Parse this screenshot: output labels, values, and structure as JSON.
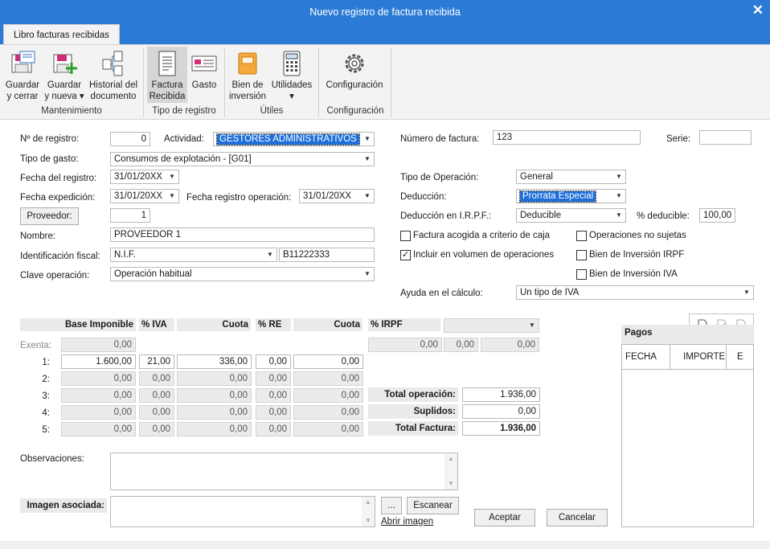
{
  "window": {
    "title": "Nuevo registro de factura recibida",
    "close": "✕"
  },
  "tab": "Libro facturas recibidas",
  "ribbon": {
    "buttons": [
      {
        "l1": "Guardar",
        "l2": "y cerrar"
      },
      {
        "l1": "Guardar",
        "l2": "y nueva ▾"
      },
      {
        "l1": "Historial del",
        "l2": "documento"
      },
      {
        "l1": "Factura",
        "l2": "Recibida"
      },
      {
        "l1": "Gasto",
        "l2": ""
      },
      {
        "l1": "Bien de",
        "l2": "inversión"
      },
      {
        "l1": "Utilidades",
        "l2": "▾"
      },
      {
        "l1": "Configuración",
        "l2": ""
      }
    ],
    "groups": [
      "Mantenimiento",
      "Tipo de registro",
      "Útiles",
      "Configuración"
    ]
  },
  "form": {
    "num_registro_label": "Nº de registro:",
    "num_registro": "0",
    "actividad_label": "Actividad:",
    "actividad": "GESTORES ADMINISTRATIVOS",
    "tipo_gasto_label": "Tipo de gasto:",
    "tipo_gasto": "Consumos de explotación - [G01]",
    "fecha_registro_label": "Fecha del registro:",
    "fecha_registro": "31/01/20XX",
    "fecha_expedicion_label": "Fecha expedición:",
    "fecha_expedicion": "31/01/20XX",
    "fecha_reg_op_label": "Fecha registro operación:",
    "fecha_reg_op": "31/01/20XX",
    "proveedor_button": "Proveedor:",
    "proveedor": "1",
    "nombre_label": "Nombre:",
    "nombre": "PROVEEDOR 1",
    "ident_label": "Identificación fiscal:",
    "ident_tipo": "N.I.F.",
    "ident_num": "B11222333",
    "clave_label": "Clave operación:",
    "clave": "Operación habitual",
    "num_factura_label": "Número de factura:",
    "num_factura": "123",
    "serie_label": "Serie:",
    "serie": "",
    "tipo_op_label": "Tipo de Operación:",
    "tipo_op": "General",
    "deduccion_label": "Deducción:",
    "deduccion": "Prorrata Especial",
    "deduccion_irpf_label": "Deducción en I.R.P.F.:",
    "deduccion_irpf": "Deducible",
    "pct_deducible_label": "% deducible:",
    "pct_deducible": "100,00",
    "chk_caja": "Factura acogida a criterio de caja",
    "chk_no_sujetas": "Operaciones no sujetas",
    "chk_volumen": "Incluir en  volumen de operaciones",
    "chk_bien_irpf": "Bien de Inversión IRPF",
    "chk_bien_iva": "Bien de Inversión IVA",
    "ayuda_label": "Ayuda en el cálculo:",
    "ayuda": "Un tipo de IVA"
  },
  "tax": {
    "headers": [
      "Base Imponible",
      "% IVA",
      "Cuota",
      "% RE",
      "Cuota",
      "% IRPF"
    ],
    "exenta_label": "Exenta:",
    "exenta": "0,00",
    "rows": [
      {
        "label": "1:",
        "base": "1.600,00",
        "iva": "21,00",
        "cuota": "336,00",
        "re": "0,00",
        "cuota_re": "0,00"
      },
      {
        "label": "2:",
        "base": "0,00",
        "iva": "0,00",
        "cuota": "0,00",
        "re": "0,00",
        "cuota_re": "0,00"
      },
      {
        "label": "3:",
        "base": "0,00",
        "iva": "0,00",
        "cuota": "0,00",
        "re": "0,00",
        "cuota_re": "0,00"
      },
      {
        "label": "4:",
        "base": "0,00",
        "iva": "0,00",
        "cuota": "0,00",
        "re": "0,00",
        "cuota_re": "0,00"
      },
      {
        "label": "5:",
        "base": "0,00",
        "iva": "0,00",
        "cuota": "0,00",
        "re": "0,00",
        "cuota_re": "0,00"
      }
    ],
    "irpf": {
      "base": "0,00",
      "pct": "0,00",
      "cuota": "0,00"
    },
    "total_op_label": "Total operación:",
    "total_op": "1.936,00",
    "suplidos_label": "Suplidos:",
    "suplidos": "0,00",
    "total_factura_label": "Total Factura:",
    "total_factura": "1.936,00"
  },
  "pagos": {
    "title": "Pagos",
    "cols": [
      "FECHA",
      "IMPORTE",
      "E"
    ]
  },
  "bottom": {
    "observaciones_label": "Observaciones:",
    "imagen_label": "Imagen asociada:",
    "browse": "...",
    "escanear": "Escanear",
    "abrir": "Abrir imagen",
    "aceptar": "Aceptar",
    "cancelar": "Cancelar"
  }
}
